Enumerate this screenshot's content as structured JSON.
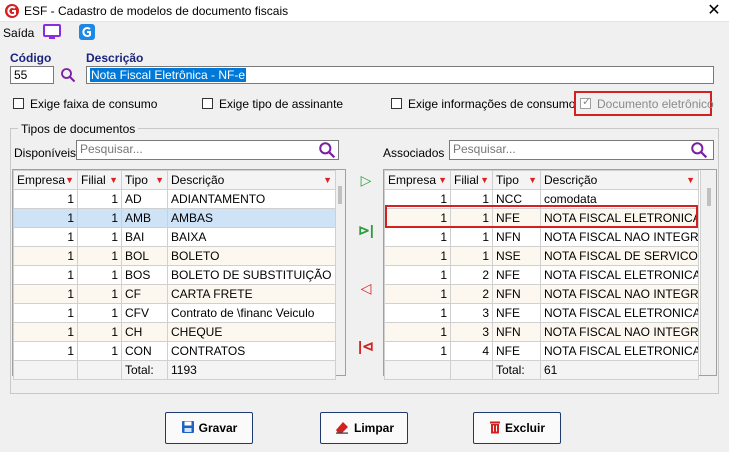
{
  "window": {
    "title": "ESF - Cadastro de modelos de documento fiscais"
  },
  "menu": {
    "saida": "Saída"
  },
  "header": {
    "codigo_label": "Código",
    "codigo_value": "55",
    "descricao_label": "Descrição",
    "descricao_value": "Nota Fiscal Eletrônica - NF-e"
  },
  "checks": {
    "faixa": "Exige faixa de consumo",
    "assinante": "Exige tipo de assinante",
    "info_consumo": "Exige informações de consumo",
    "doc_eletronico": "Documento eletrônico"
  },
  "group": {
    "title": "Tipos de documentos"
  },
  "left": {
    "label": "Disponíveis",
    "search_placeholder": "Pesquisar...",
    "columns": [
      "Empresa",
      "Filial",
      "Tipo",
      "Descrição"
    ],
    "rows": [
      [
        "1",
        "1",
        "AD",
        "ADIANTAMENTO"
      ],
      [
        "1",
        "1",
        "AMB",
        "AMBAS"
      ],
      [
        "1",
        "1",
        "BAI",
        "BAIXA"
      ],
      [
        "1",
        "1",
        "BOL",
        "BOLETO"
      ],
      [
        "1",
        "1",
        "BOS",
        "BOLETO DE SUBSTITUIÇÃO"
      ],
      [
        "1",
        "1",
        "CF",
        "CARTA FRETE"
      ],
      [
        "1",
        "1",
        "CFV",
        "Contrato de \\financ Veiculo"
      ],
      [
        "1",
        "1",
        "CH",
        "CHEQUE"
      ],
      [
        "1",
        "1",
        "CON",
        "CONTRATOS"
      ]
    ],
    "total_label": "Total:",
    "total_value": "1193"
  },
  "right": {
    "label": "Associados",
    "search_placeholder": "Pesquisar...",
    "columns": [
      "Empresa",
      "Filial",
      "Tipo",
      "Descrição"
    ],
    "rows": [
      [
        "1",
        "1",
        "NCC",
        "comodata"
      ],
      [
        "1",
        "1",
        "NFE",
        "NOTA FISCAL ELETRONICA"
      ],
      [
        "1",
        "1",
        "NFN",
        "NOTA FISCAL NAO INTEGRA"
      ],
      [
        "1",
        "1",
        "NSE",
        "NOTA FISCAL DE SERVICO"
      ],
      [
        "1",
        "2",
        "NFE",
        "NOTA FISCAL ELETRONICA"
      ],
      [
        "1",
        "2",
        "NFN",
        "NOTA FISCAL NAO INTEGRA"
      ],
      [
        "1",
        "3",
        "NFE",
        "NOTA FISCAL ELETRONICA"
      ],
      [
        "1",
        "3",
        "NFN",
        "NOTA FISCAL NAO INTEGRA"
      ],
      [
        "1",
        "4",
        "NFE",
        "NOTA FISCAL ELETRONICA"
      ]
    ],
    "total_label": "Total:",
    "total_value": "61"
  },
  "buttons": {
    "gravar": "Gravar",
    "limpar": "Limpar",
    "excluir": "Excluir"
  },
  "colors": {
    "accent": "#1a237e",
    "highlight": "#d32020",
    "selection": "#cfe3f7"
  }
}
